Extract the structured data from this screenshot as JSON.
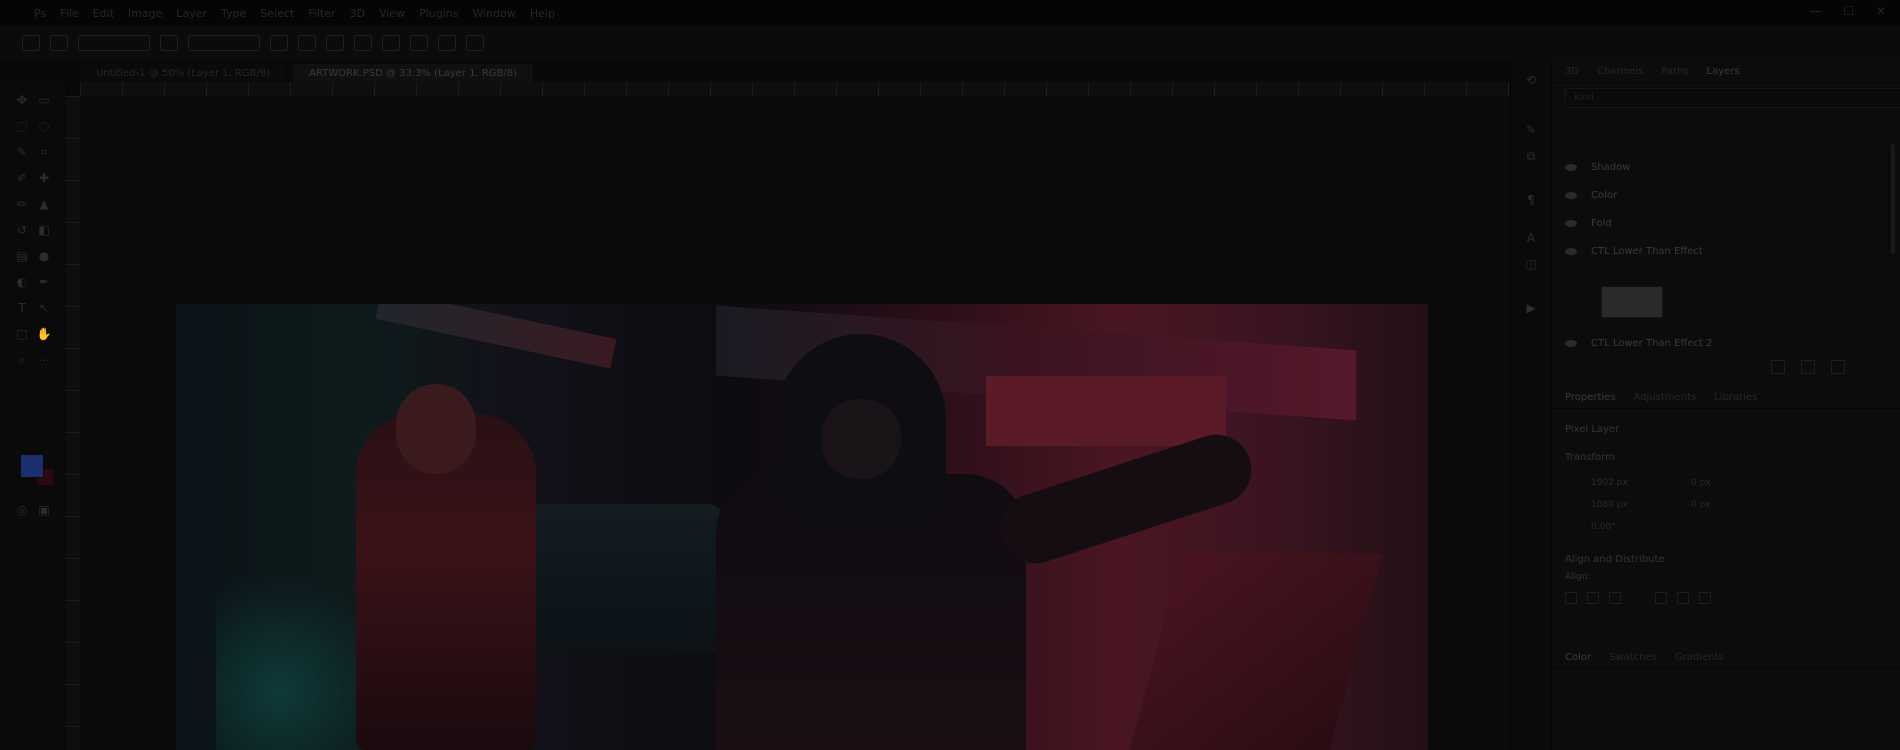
{
  "menubar": {
    "items": [
      "Ps",
      "File",
      "Edit",
      "Image",
      "Layer",
      "Type",
      "Select",
      "Filter",
      "3D",
      "View",
      "Plugins",
      "Window",
      "Help"
    ],
    "window_controls": [
      "—",
      "☐",
      "✕"
    ]
  },
  "document_tabs": [
    {
      "label": "Untitled-1 @ 50% (Layer 1, RGB/8)"
    },
    {
      "label": "ARTWORK.PSD @ 33.3% (Layer 1, RGB/8)"
    }
  ],
  "right_panel": {
    "layer_tabs": [
      "3D",
      "Channels",
      "Paths",
      "Layers"
    ],
    "layer_filter_placeholder": "Kind",
    "layers": [
      "Shadow",
      "Color",
      "Fold",
      "CTL Lower Than Effect"
    ],
    "last_layer": "CTL Lower Than Effect 2",
    "properties_tabs": [
      "Properties",
      "Adjustments",
      "Libraries"
    ],
    "properties": {
      "header": "Pixel Layer",
      "transform_label": "Transform",
      "width": "1902 px",
      "height": "1080 px",
      "x": "0 px",
      "y": "0 px",
      "angle": "0.00°",
      "align_label": "Align and Distribute",
      "align_sub": "Align:"
    },
    "bottom_tabs": [
      "Color",
      "Swatches",
      "Gradients"
    ]
  },
  "toolbar": {
    "colors": {
      "foreground": "#1b2f6e",
      "background": "#2a0c10"
    }
  }
}
